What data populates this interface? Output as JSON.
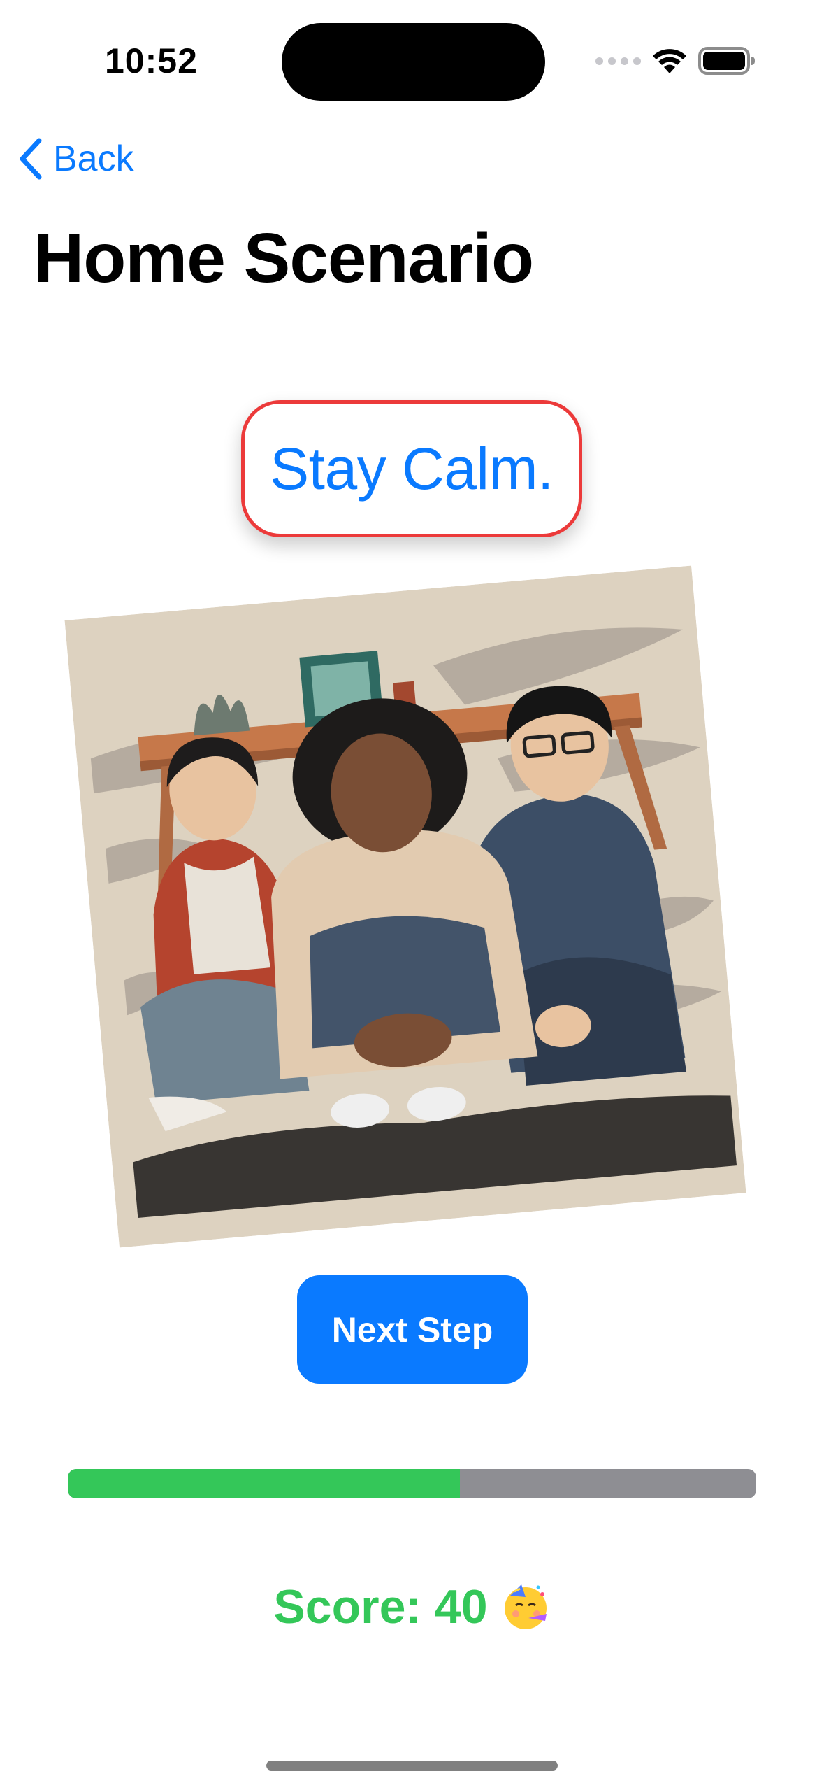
{
  "status_bar": {
    "time": "10:52",
    "icons": [
      "cellular-icon",
      "wifi-icon",
      "battery-icon"
    ]
  },
  "nav": {
    "back_label": "Back",
    "title": "Home Scenario"
  },
  "step": {
    "text": "Stay Calm."
  },
  "illustration": {
    "subject": "three people crouching under a table"
  },
  "actions": {
    "next_label": "Next Step"
  },
  "progress": {
    "fraction": 0.57
  },
  "score": {
    "label": "Score: 40",
    "emoji": "partying-face-icon"
  },
  "colors": {
    "accent": "#0a7aff",
    "success": "#34c759",
    "highlight_border": "#ec3a3a",
    "track": "#8e8e93"
  }
}
